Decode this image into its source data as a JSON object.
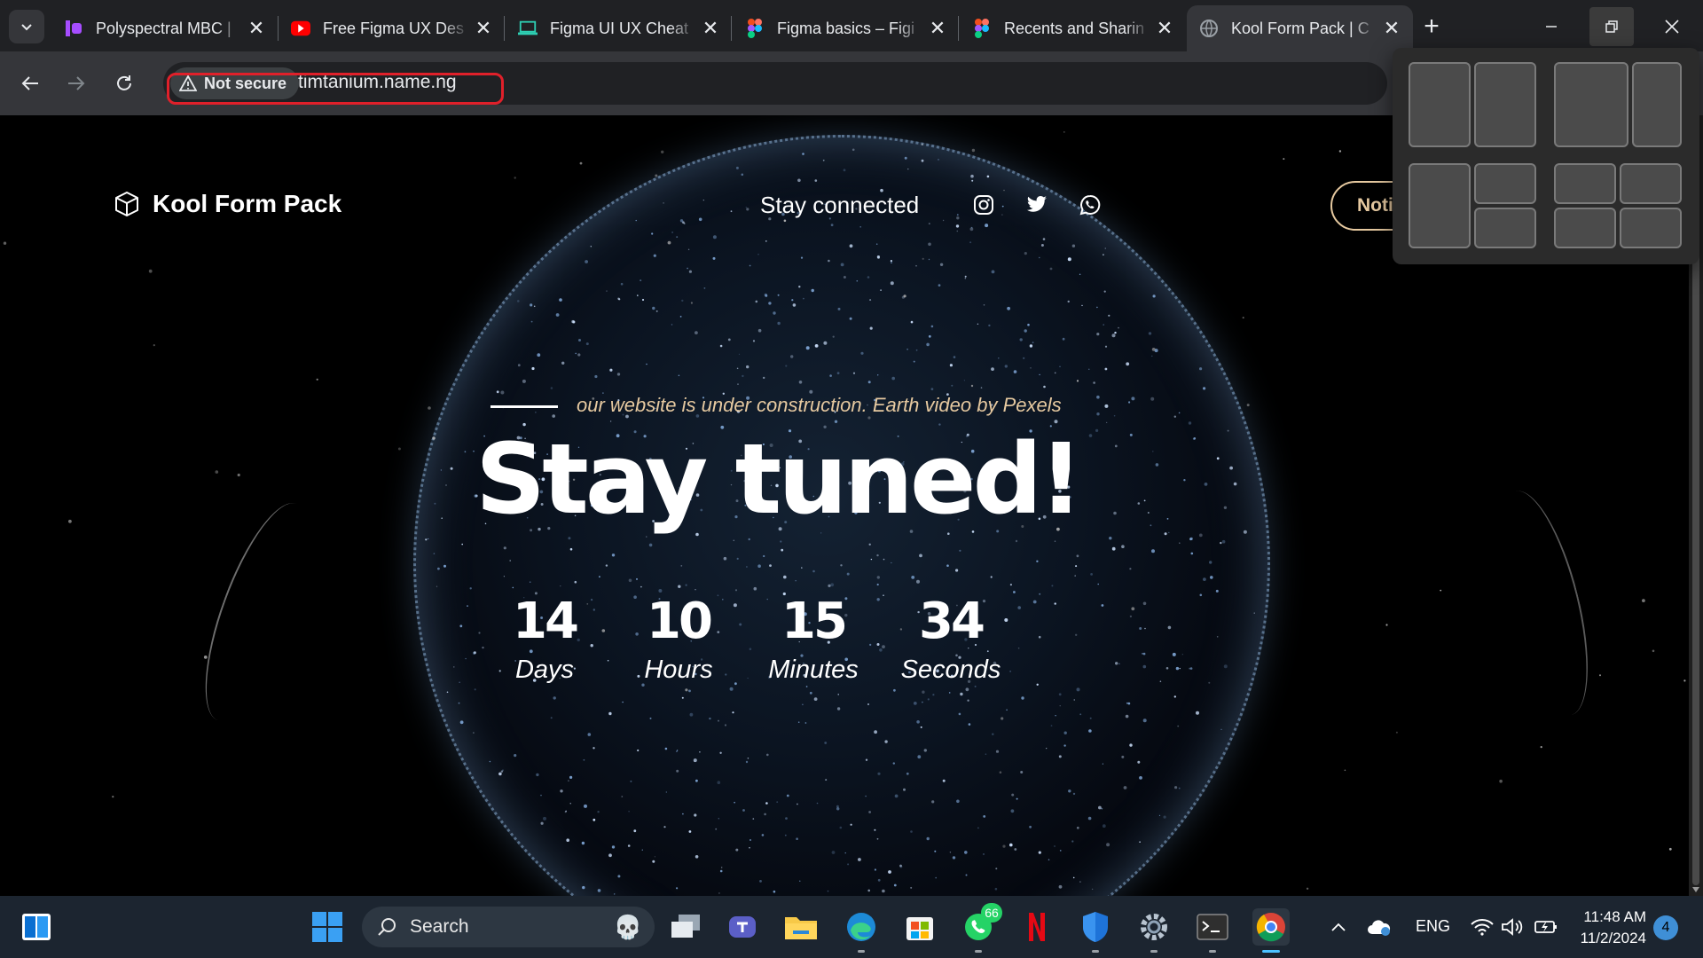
{
  "browser": {
    "tabs": [
      {
        "title": "Polyspectral MBC |",
        "favicon": "polyspectral-icon",
        "active": false
      },
      {
        "title": "Free Figma UX Des",
        "favicon": "youtube-icon",
        "active": false
      },
      {
        "title": "Figma UI UX Cheat",
        "favicon": "laptop-icon",
        "active": false
      },
      {
        "title": "Figma basics – Figi",
        "favicon": "figma-icon",
        "active": false
      },
      {
        "title": "Recents and Sharin",
        "favicon": "figma-icon",
        "active": false
      },
      {
        "title": "Kool Form Pack | C",
        "favicon": "globe-icon",
        "active": true
      }
    ],
    "new_tab_label": "+",
    "security_label": "Not secure",
    "url": "timtanium.name.ng",
    "colors": {
      "highlight": "#e0202a",
      "tab_bg": "#202124",
      "toolbar_bg": "#35363a"
    }
  },
  "site": {
    "brand": "Kool Form Pack",
    "stay_connected": "Stay connected",
    "social_icons": [
      "instagram-icon",
      "twitter-icon",
      "whatsapp-icon"
    ],
    "notify_label": "Noti",
    "caption": "our website is under construction. Earth video by Pexels",
    "title": "Stay tuned!",
    "countdown": [
      {
        "value": "14",
        "unit": "Days"
      },
      {
        "value": "10",
        "unit": "Hours"
      },
      {
        "value": "15",
        "unit": "Minutes"
      },
      {
        "value": "34",
        "unit": "Seconds"
      }
    ],
    "colors": {
      "accent": "#e6c9a0",
      "text": "#ffffff"
    }
  },
  "taskbar": {
    "search_label": "Search",
    "whatsapp_badge": "66",
    "language": "ENG",
    "time": "11:48 AM",
    "date": "11/2/2024",
    "notification_count": "4",
    "apps": [
      "start-icon",
      "search-icon",
      "task-view-icon",
      "teams-icon",
      "file-explorer-icon",
      "edge-icon",
      "store-icon",
      "whatsapp-icon",
      "netflix-icon",
      "defender-icon",
      "settings-icon",
      "terminal-icon",
      "chrome-icon"
    ]
  }
}
